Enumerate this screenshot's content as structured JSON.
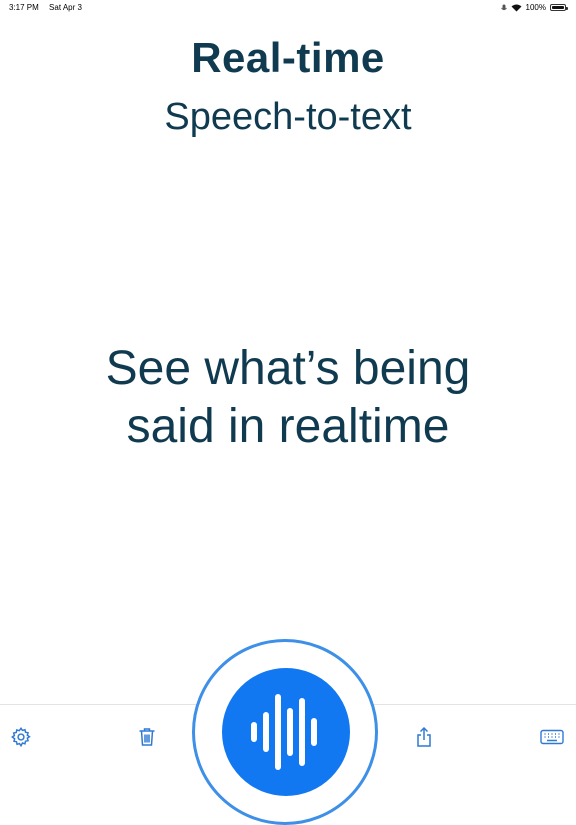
{
  "status_bar": {
    "time": "3:17 PM",
    "date": "Sat Apr 3",
    "battery": "100%",
    "battery_level": 1.0
  },
  "header": {
    "title": "Real-time",
    "subtitle": "Speech-to-text"
  },
  "main": {
    "headline_line1": "See what’s being",
    "headline_line2": "said in realtime"
  },
  "toolbar": {
    "items": [
      "gear-icon",
      "trash-icon",
      "microphone-waveform-icon",
      "share-icon",
      "keyboard-icon"
    ]
  },
  "colors": {
    "text": "#0f3a4f",
    "accent": "#2f79d6",
    "mic_button": "#1178f2",
    "mic_ring": "#3d8fe8"
  }
}
